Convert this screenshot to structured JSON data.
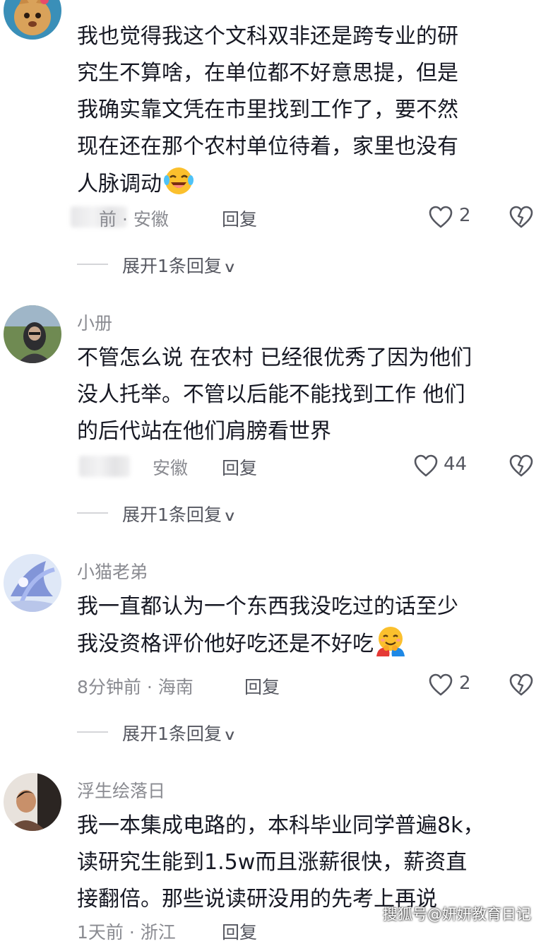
{
  "comments": [
    {
      "username": "",
      "lines": [
        "我也觉得我这个文科双非还是跨专业的研",
        "究生不算啥，在单位都不好意思提，但是",
        "我确实靠文凭在市里找到工作了，要不然",
        "现在还在那个农村单位待着，家里也没有",
        "人脉调动"
      ],
      "emoji": "laughing-crying-emoji",
      "meta": "前 · 安徽",
      "reply_label": "回复",
      "likes": "2",
      "expand_label": "展开1条回复"
    },
    {
      "username": "小册",
      "lines": [
        "不管怎么说 在农村 已经很优秀了因为他们",
        "没人托举。不管以后能不能找到工作 他们",
        "的后代站在他们肩膀看世界"
      ],
      "meta": "安徽",
      "reply_label": "回复",
      "likes": "44",
      "expand_label": "展开1条回复"
    },
    {
      "username": "小猫老弟",
      "lines": [
        "我一直都认为一个东西我没吃过的话至少",
        "我没资格评价他好吃还是不好吃"
      ],
      "emoji": "hugging-emoji",
      "meta": "8分钟前 · 海南",
      "reply_label": "回复",
      "likes": "2",
      "expand_label": "展开1条回复"
    },
    {
      "username": "浮生绘落日",
      "lines": [
        "我一本集成电路的，本科毕业同学普遍8k，",
        "读研究生能到1.5w而且涨薪很快，薪资直",
        "接翻倍。那些说读研没用的先考上再说"
      ],
      "meta": "1天前 · 浙江",
      "reply_label": "回复"
    }
  ],
  "watermark": "搜狐号@妍妍教育日记",
  "colors": {
    "text": "#161823",
    "secondary": "#8a8b91",
    "action": "#555760",
    "background": "#ffffff"
  }
}
